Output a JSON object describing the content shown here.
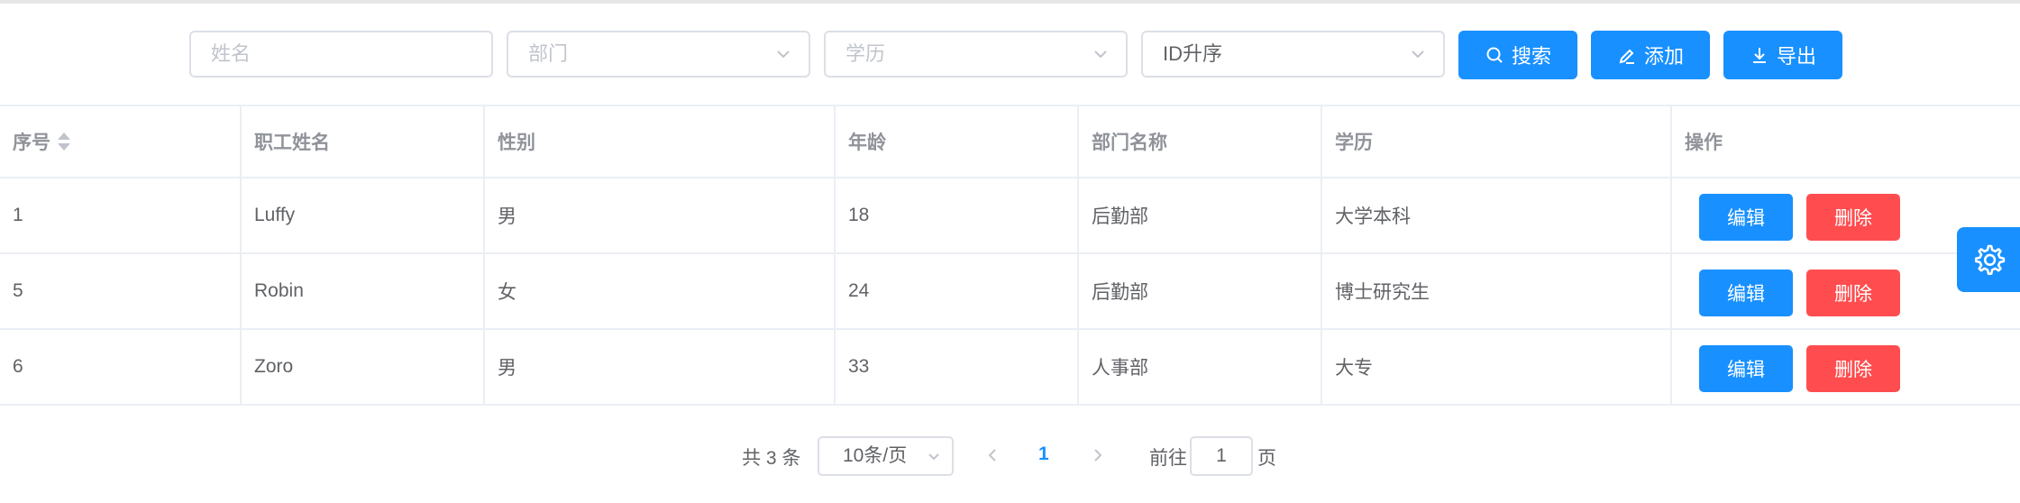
{
  "filters": {
    "name_placeholder": "姓名",
    "dept_placeholder": "部门",
    "edu_placeholder": "学历",
    "sort_value": "ID升序"
  },
  "toolbar": {
    "search_label": "搜索",
    "add_label": "添加",
    "export_label": "导出"
  },
  "table": {
    "headers": [
      "序号",
      "职工姓名",
      "性别",
      "年龄",
      "部门名称",
      "学历",
      "操作"
    ],
    "rows": [
      {
        "id": "1",
        "name": "Luffy",
        "gender": "男",
        "age": "18",
        "dept": "后勤部",
        "edu": "大学本科"
      },
      {
        "id": "5",
        "name": "Robin",
        "gender": "女",
        "age": "24",
        "dept": "后勤部",
        "edu": "博士研究生"
      },
      {
        "id": "6",
        "name": "Zoro",
        "gender": "男",
        "age": "33",
        "dept": "人事部",
        "edu": "大专"
      }
    ],
    "edit_label": "编辑",
    "delete_label": "删除"
  },
  "pagination": {
    "total_text": "共 3 条",
    "page_size": "10条/页",
    "current_page": "1",
    "goto_label": "前往",
    "goto_value": "1",
    "page_unit": "页"
  },
  "colors": {
    "primary": "#1890ff",
    "danger": "#ff4d4f",
    "border": "#ebeef5"
  }
}
